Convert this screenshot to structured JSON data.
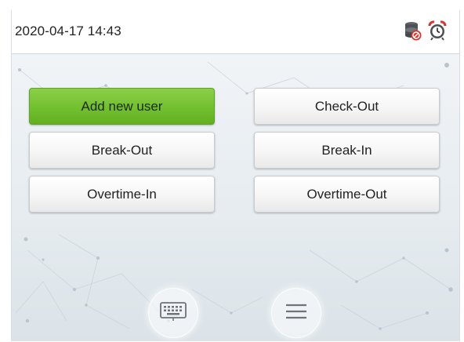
{
  "status_bar": {
    "datetime": "2020-04-17 14:43",
    "icons": [
      "database-blocked-icon",
      "alarm-clock-icon"
    ]
  },
  "buttons": {
    "add_new_user": "Add new user",
    "check_out": "Check-Out",
    "break_out": "Break-Out",
    "break_in": "Break-In",
    "overtime_in": "Overtime-In",
    "overtime_out": "Overtime-Out"
  },
  "bottom": {
    "icons": [
      "keyboard-icon",
      "menu-icon"
    ]
  },
  "colors": {
    "accent_green": "#72bf2f",
    "status_red": "#d9342b"
  }
}
